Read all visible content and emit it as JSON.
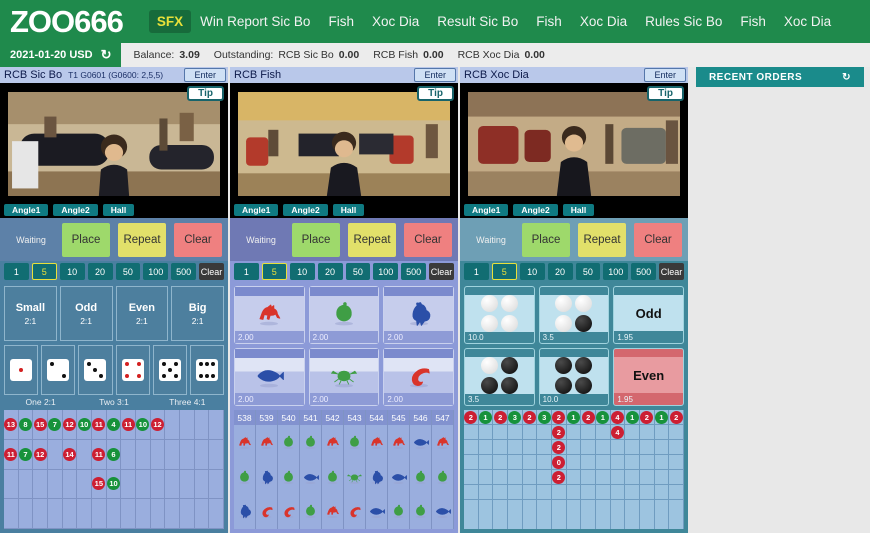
{
  "brand": "ZOO666",
  "nav": [
    {
      "label": "SFX",
      "highlight": true
    },
    {
      "label": "Win Report Sic Bo",
      "highlight": false
    },
    {
      "label": "Fish",
      "highlight": false
    },
    {
      "label": "Xoc Dia",
      "highlight": false
    },
    {
      "label": "Result Sic Bo",
      "highlight": false
    },
    {
      "label": "Fish",
      "highlight": false
    },
    {
      "label": "Xoc Dia",
      "highlight": false
    },
    {
      "label": "Rules Sic Bo",
      "highlight": false
    },
    {
      "label": "Fish",
      "highlight": false
    },
    {
      "label": "Xoc Dia",
      "highlight": false
    }
  ],
  "infobar": {
    "date": "2021-01-20 USD",
    "refresh_icon": "refresh-icon",
    "balance_label": "Balance:",
    "balance_value": "3.09",
    "outstanding_label": "Outstanding:",
    "outstanding": [
      {
        "name": "RCB Sic Bo",
        "value": "0.00"
      },
      {
        "name": "RCB Fish",
        "value": "0.00"
      },
      {
        "name": "RCB Xoc Dia",
        "value": "0.00"
      }
    ]
  },
  "common": {
    "enter": "Enter",
    "tip": "Tip",
    "angles": [
      "Angle1",
      "Angle2",
      "Hall"
    ],
    "waiting": "Waiting",
    "actions": [
      "Place",
      "Repeat",
      "Clear"
    ],
    "chips": [
      "1",
      "5",
      "10",
      "20",
      "50",
      "100",
      "500"
    ],
    "chip_clear": "Clear",
    "chip_selected": "5"
  },
  "panels": [
    {
      "id": "sicbo",
      "title": "RCB Sic Bo",
      "round": "T1 G0601 (G0600: 2,5,5)"
    },
    {
      "id": "fish",
      "title": "RCB Fish",
      "round": ""
    },
    {
      "id": "xocdia",
      "title": "RCB Xoc Dia",
      "round": ""
    }
  ],
  "sicbo": {
    "main_bets": [
      {
        "name": "Small",
        "odds": "2:1"
      },
      {
        "name": "Odd",
        "odds": "2:1"
      },
      {
        "name": "Even",
        "odds": "2:1"
      },
      {
        "name": "Big",
        "odds": "2:1"
      }
    ],
    "dice_bets": [
      {
        "pips": 1,
        "color": "red"
      },
      {
        "pips": 2,
        "color": "black"
      },
      {
        "pips": 3,
        "color": "black"
      },
      {
        "pips": 4,
        "color": "red"
      },
      {
        "pips": 5,
        "color": "black"
      },
      {
        "pips": 6,
        "color": "black"
      }
    ],
    "dice_labels": [
      "One 2:1",
      "Two 3:1",
      "Three 4:1"
    ],
    "road_columns": 15,
    "road_rows": 4,
    "road": [
      [
        "13r",
        "11r"
      ],
      [
        "8g",
        "7g"
      ],
      [
        "15r",
        "12r"
      ],
      [
        "7g"
      ],
      [
        "12r",
        "14r"
      ],
      [
        "10g"
      ],
      [
        "11r",
        "11r",
        "15r"
      ],
      [
        "4g",
        "6g",
        "10g"
      ],
      [
        "11r"
      ],
      [
        "10g"
      ],
      [
        "12r"
      ],
      [],
      [],
      [],
      []
    ]
  },
  "fish": {
    "bets": [
      {
        "animal": "deer",
        "color": "#d9342b",
        "amount": "2.00",
        "water": false
      },
      {
        "animal": "gourd",
        "color": "#3f9e45",
        "amount": "2.00",
        "water": false
      },
      {
        "animal": "rooster",
        "color": "#2b4fa8",
        "amount": "2.00",
        "water": false
      },
      {
        "animal": "fish",
        "color": "#2b4fa8",
        "amount": "2.00",
        "water": true
      },
      {
        "animal": "crab",
        "color": "#3f9e45",
        "amount": "2.00",
        "water": true
      },
      {
        "animal": "shrimp",
        "color": "#d9342b",
        "amount": "2.00",
        "water": true
      }
    ],
    "road_headers": [
      "538",
      "539",
      "540",
      "541",
      "542",
      "543",
      "544",
      "545",
      "546",
      "547"
    ],
    "road": [
      [
        "deer",
        "gourd",
        "rooster"
      ],
      [
        "deer",
        "rooster",
        "shrimp"
      ],
      [
        "gourd",
        "gourd",
        "shrimp"
      ],
      [
        "gourd",
        "fish",
        "gourd"
      ],
      [
        "deer",
        "gourd",
        "deer"
      ],
      [
        "gourd",
        "crab",
        "shrimp"
      ],
      [
        "deer",
        "rooster",
        "fish"
      ],
      [
        "deer",
        "fish",
        "gourd"
      ],
      [
        "fish",
        "gourd",
        "gourd"
      ],
      [
        "deer",
        "gourd",
        "fish"
      ]
    ]
  },
  "xocdia": {
    "bets": [
      {
        "type": "coins",
        "coins": [
          "w",
          "w",
          "w",
          "w"
        ],
        "amount": "10.0",
        "label": ""
      },
      {
        "type": "coins",
        "coins": [
          "w",
          "w",
          "w",
          "b"
        ],
        "amount": "3.5",
        "label": ""
      },
      {
        "type": "text",
        "label": "Odd",
        "amount": "1.95",
        "style": "plain"
      },
      {
        "type": "coins",
        "coins": [
          "w",
          "b",
          "b",
          "b"
        ],
        "amount": "3.5",
        "label": ""
      },
      {
        "type": "coins",
        "coins": [
          "b",
          "b",
          "b",
          "b"
        ],
        "amount": "10.0",
        "label": ""
      },
      {
        "type": "text",
        "label": "Even",
        "amount": "1.95",
        "style": "even"
      }
    ],
    "road_columns": 15,
    "road_rows": 6,
    "road": [
      [
        "2r"
      ],
      [
        "1g"
      ],
      [
        "2r"
      ],
      [
        "3g"
      ],
      [
        "2r"
      ],
      [
        "3g"
      ],
      [
        "2r",
        "2r",
        "2r",
        "0r",
        "2r"
      ],
      [
        "1g"
      ],
      [
        "2r"
      ],
      [
        "1g"
      ],
      [
        "4r",
        "4r"
      ],
      [
        "1g"
      ],
      [
        "2r"
      ],
      [
        "1g"
      ],
      [
        "2r"
      ]
    ]
  },
  "side": {
    "orders_title": "RECENT ORDERS",
    "orders_refresh_icon": "refresh-icon"
  }
}
